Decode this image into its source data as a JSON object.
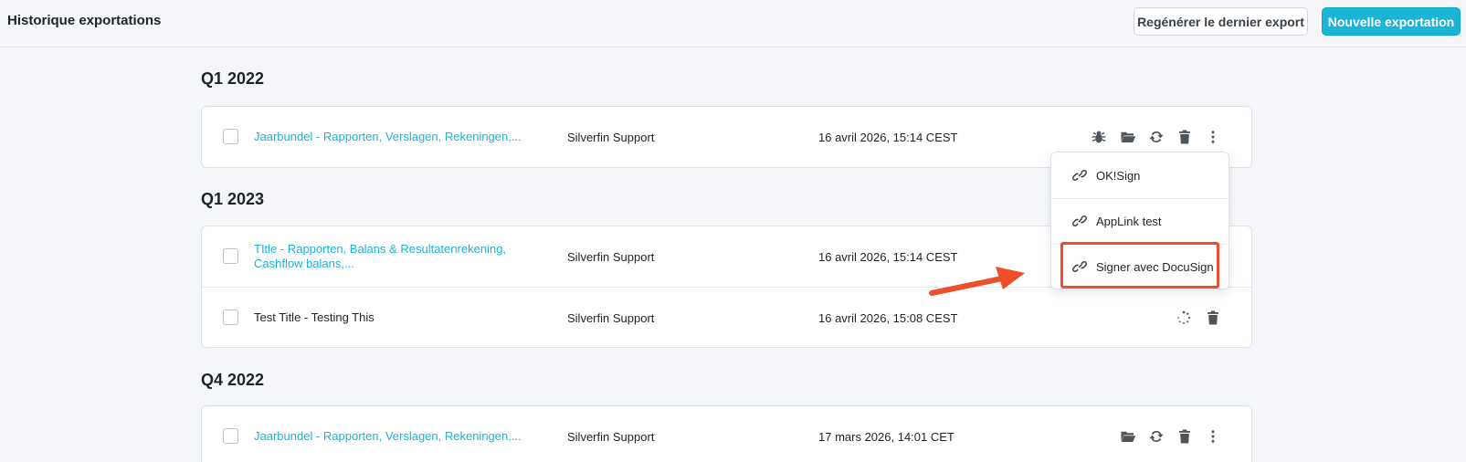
{
  "header": {
    "title": "Historique exportations",
    "regenerate_label": "Regénérer le dernier export",
    "new_export_label": "Nouvelle exportation"
  },
  "sections": [
    {
      "title": "Q1 2022",
      "rows": [
        {
          "title": "Jaarbundel - Rapporten, Verslagen, Rekeningen,...",
          "author": "Silverfin Support",
          "date": "16 avril 2026, 15:14 CEST"
        }
      ]
    },
    {
      "title": "Q1 2023",
      "rows": [
        {
          "title": "TItle - Rapporten, Balans & Resultatenrekening, Cashflow balans,...",
          "author": "Silverfin Support",
          "date": "16 avril 2026, 15:14 CEST"
        },
        {
          "title": "Test Title - Testing This",
          "author": "Silverfin Support",
          "date": "16 avril 2026, 15:08 CEST"
        }
      ]
    },
    {
      "title": "Q4 2022",
      "rows": [
        {
          "title": "Jaarbundel - Rapporten, Verslagen, Rekeningen,...",
          "author": "Silverfin Support",
          "date": "17 mars 2026, 14:01 CET"
        }
      ]
    }
  ],
  "dropdown": {
    "items": [
      {
        "label": "OK!Sign",
        "icon": "link-icon"
      },
      {
        "label": "AppLink test",
        "icon": "link-icon"
      },
      {
        "label": "Signer avec DocuSign",
        "icon": "link-icon"
      }
    ]
  },
  "colors": {
    "accent": "#1bb4d6",
    "highlight": "#ee4e2a",
    "background": "#f4f6f9"
  }
}
